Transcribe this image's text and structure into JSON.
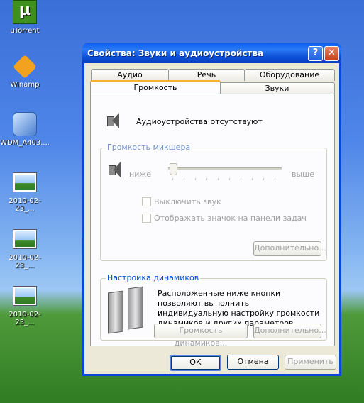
{
  "desktop": {
    "icons": [
      {
        "label": "uTorrent"
      },
      {
        "label": "Winamp"
      },
      {
        "label": "WDM_A403...."
      },
      {
        "label": "2010-02-23_..."
      },
      {
        "label": "2010-02-23_..."
      },
      {
        "label": "2010-02-23_..."
      }
    ]
  },
  "window": {
    "title": "Свойства: Звуки и аудиоустройства",
    "help_button": "?",
    "close_button": "✕"
  },
  "tabs": {
    "row1": [
      "Аудио",
      "Речь",
      "Оборудование"
    ],
    "row2": [
      "Громкость",
      "Звуки"
    ],
    "active": "Громкость"
  },
  "volume": {
    "status_text": "Аудиоустройства отсутствуют",
    "mixer_group": {
      "title": "Громкость микшера",
      "low_label": "ниже",
      "high_label": "выше",
      "level": 0,
      "mute_label": "Выключить звук",
      "mute_checked": false,
      "tray_label": "Отображать значок на панели задач",
      "tray_checked": false,
      "advanced_button": "Дополнительно..."
    },
    "speakers_group": {
      "title": "Настройка динамиков",
      "description": "Расположенные ниже кнопки позволяют выполнить индивидуальную настройку громкости динамиков и других параметров.",
      "speaker_volume_button": "Громкость динамиков...",
      "advanced_button": "Дополнительно..."
    }
  },
  "buttons": {
    "ok": "ОК",
    "cancel": "Отмена",
    "apply": "Применить"
  }
}
